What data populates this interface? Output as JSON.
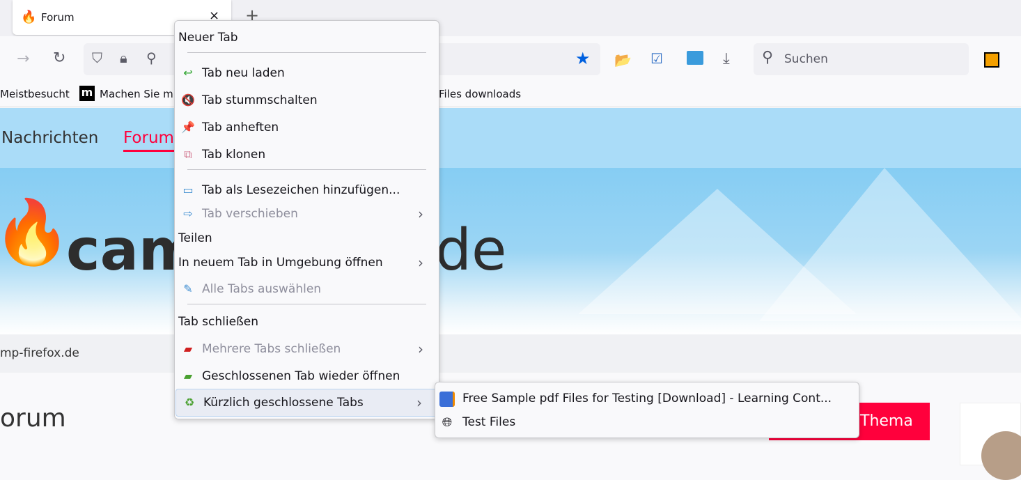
{
  "tab": {
    "title": "Forum",
    "close": "×",
    "new_tab": "+"
  },
  "toolbar": {
    "search_placeholder": "Suchen"
  },
  "bookmarks": {
    "items": [
      "Meistbesucht",
      "Machen Sie m",
      "Files downloads"
    ]
  },
  "page": {
    "nav": [
      "Nachrichten",
      "Forum"
    ],
    "logo_left": "cam",
    "logo_right": "de",
    "breadcrumb": "mp-firefox.de",
    "heading": "orum",
    "button": "Thema",
    "accent": "#ff003c"
  },
  "context_menu": {
    "items": [
      {
        "label": "Neuer Tab"
      },
      {
        "label": "Tab neu laden"
      },
      {
        "label": "Tab stummschalten"
      },
      {
        "label": "Tab anheften"
      },
      {
        "label": "Tab klonen"
      },
      {
        "label": "Tab als Lesezeichen hinzufügen..."
      },
      {
        "label": "Tab verschieben"
      },
      {
        "label": "Teilen"
      },
      {
        "label": "In neuem Tab in Umgebung öffnen"
      },
      {
        "label": "Alle Tabs auswählen"
      },
      {
        "label": "Tab schließen"
      },
      {
        "label": "Mehrere Tabs schließen"
      },
      {
        "label": "Geschlossenen Tab wieder öffnen"
      },
      {
        "label": "Kürzlich geschlossene Tabs"
      }
    ]
  },
  "submenu": {
    "items": [
      {
        "label": "Free Sample pdf Files for Testing [Download] - Learning Cont..."
      },
      {
        "label": "Test Files"
      }
    ]
  }
}
